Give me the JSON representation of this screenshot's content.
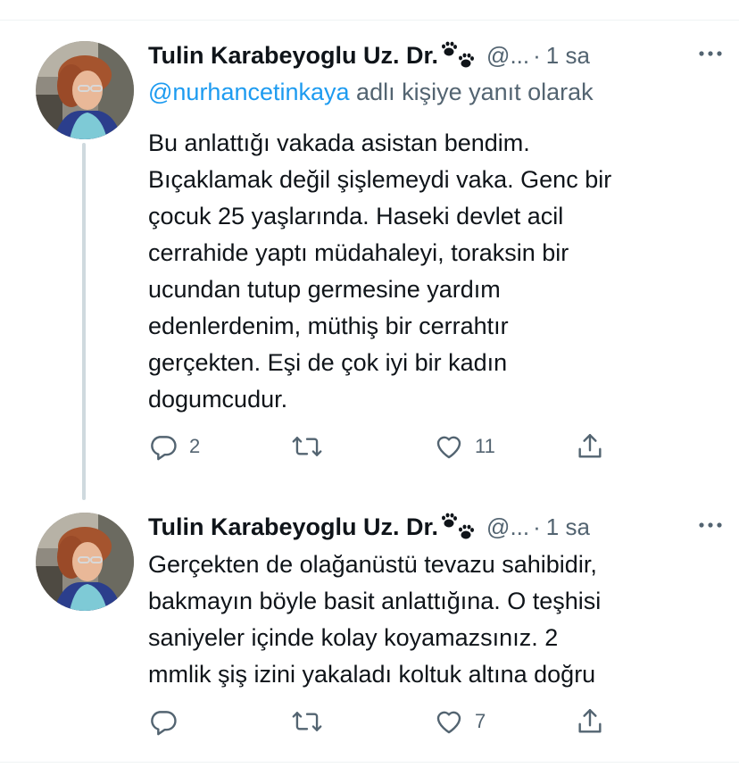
{
  "tweets": [
    {
      "display_name": "Tulin Karabeyoglu Uz. Dr.",
      "handle": "@...",
      "separator": "·",
      "time": "1 sa",
      "reply_to": {
        "mention": "@nurhancetinkaya",
        "suffix": " adlı kişiye yanıt olarak"
      },
      "text": "Bu anlattığı vakada asistan bendim.\nBıçaklamak değil şişlemeydi vaka. Genc bir\nçocuk 25 yaşlarında. Haseki devlet acil\ncerrahide yaptı müdahaleyi,  toraksin bir\nucundan tutup germesine yardım\nedenlerdenim, müthiş bir cerrahtır\ngerçekten. Eşi de çok iyi bir kadın\ndogumcudur.",
      "replies": "2",
      "retweets": "",
      "likes": "11"
    },
    {
      "display_name": "Tulin Karabeyoglu Uz. Dr.",
      "handle": "@...",
      "separator": "·",
      "time": "1 sa",
      "text": "Gerçekten de olağanüstü tevazu sahibidir,\nbakmayın böyle basit anlattığına. O teşhisi\nsaniyeler içinde kolay koyamazsınız. 2\nmmlik şiş izini yakaladı koltuk altına doğru",
      "replies": "",
      "retweets": "",
      "likes": "7"
    }
  ],
  "icons": {
    "paw": "paw-prints-icon",
    "more": "more-icon",
    "reply": "reply-icon",
    "retweet": "retweet-icon",
    "like": "heart-icon",
    "share": "share-icon"
  },
  "colors": {
    "text": "#0f1419",
    "secondary": "#536471",
    "link": "#1d9bf0",
    "thread_line": "#cfd9de",
    "divider": "#eff3f4"
  }
}
